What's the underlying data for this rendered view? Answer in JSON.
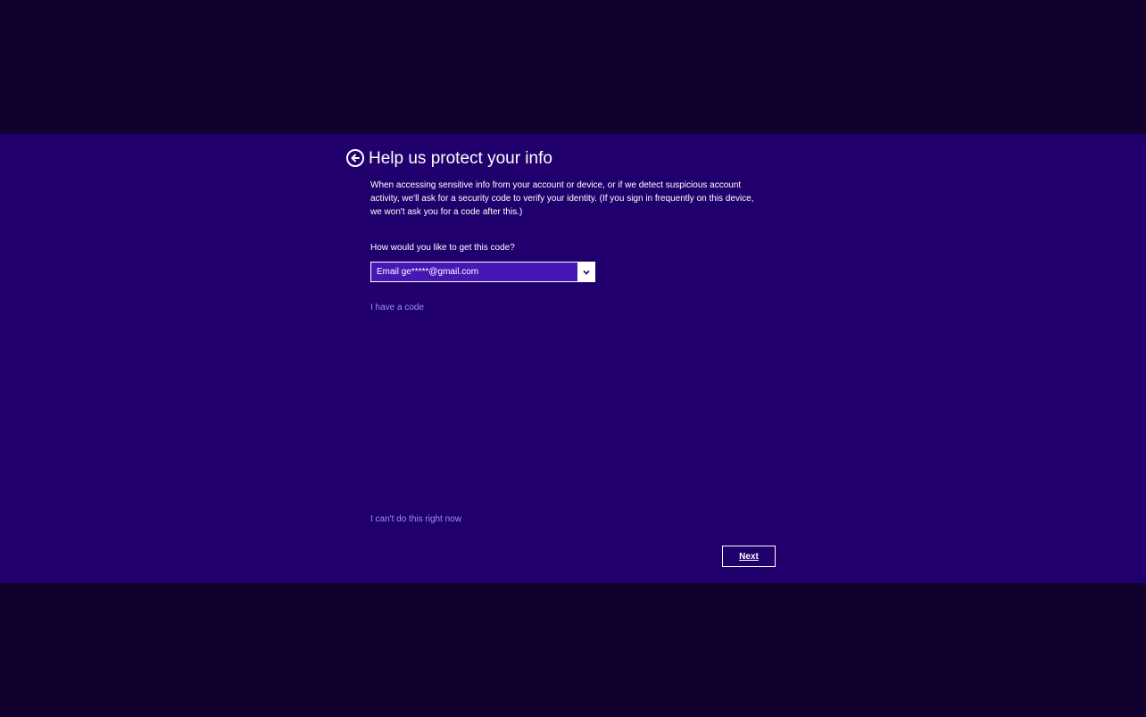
{
  "colors": {
    "outer_background": "#12002f",
    "dialog_background": "#21006e",
    "select_fill": "#4617b4",
    "link": "#9c8cff",
    "text": "#ffffff"
  },
  "header": {
    "back_icon": "back-arrow-circle-icon",
    "title": "Help us protect your info"
  },
  "main": {
    "description": "When accessing sensitive info from your account or device, or if we detect suspicious account activity, we'll ask for a security code to verify your identity. (If you sign in frequently on this device, we won't ask you for a code after this.)",
    "question": "How would you like to get this code?",
    "method_select": {
      "selected": "Email ge*****@gmail.com",
      "arrow_icon": "chevron-down-icon"
    },
    "have_code_link": "I have a code"
  },
  "footer": {
    "cant_do_link": "I can't do this right now",
    "next_label": "Next"
  }
}
